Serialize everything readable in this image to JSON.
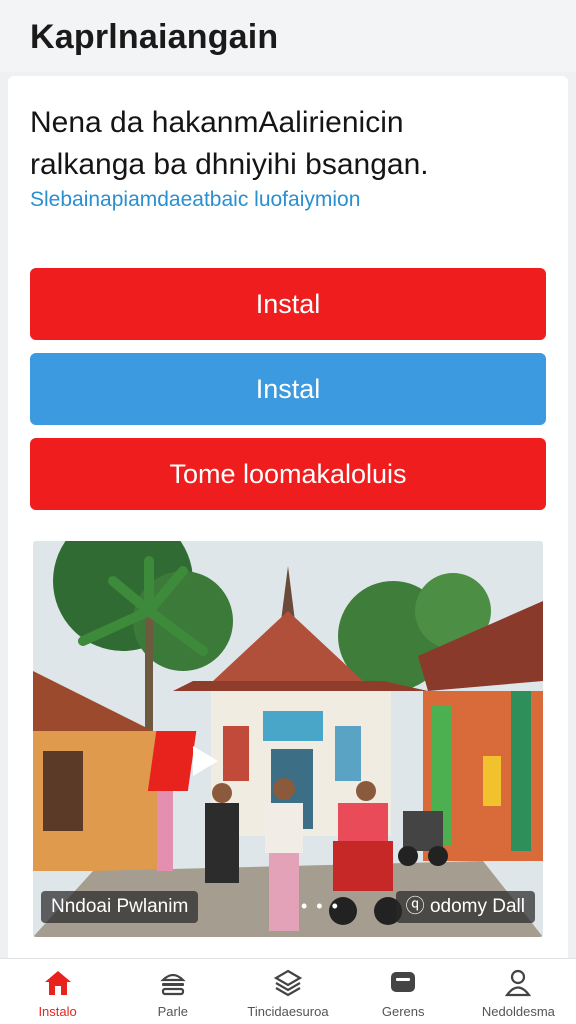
{
  "app": {
    "title": "Kaprlnaiangain"
  },
  "main": {
    "heading_line1": "Nena da hakanmAalirienicin",
    "heading_line2": "ralkanga ba dhniyihi bsangan.",
    "sublink": "Slebainapiamdaeatbaic luofaiymion"
  },
  "buttons": [
    {
      "label": "Instal",
      "color": "#ef1d1d"
    },
    {
      "label": "Instal",
      "color": "#3c9ae0"
    },
    {
      "label": "Tome loomakaloluis",
      "color": "#ef1d1d"
    }
  ],
  "video": {
    "caption_left": "Nndoai Pwlanim",
    "caption_right": "ⓠ odomy Dall",
    "dots": "• • •"
  },
  "bottom_nav": [
    {
      "label": "Instalo",
      "icon": "home-icon",
      "active": true
    },
    {
      "label": "Parle",
      "icon": "burger-icon",
      "active": false
    },
    {
      "label": "Tincidaesuroa",
      "icon": "layers-icon",
      "active": false
    },
    {
      "label": "Gerens",
      "icon": "chat-icon",
      "active": false
    },
    {
      "label": "Nedoldesma",
      "icon": "person-icon",
      "active": false
    }
  ],
  "colors": {
    "accent_red": "#e8231d",
    "accent_blue": "#3c9ae0",
    "link": "#2a8fd0"
  }
}
